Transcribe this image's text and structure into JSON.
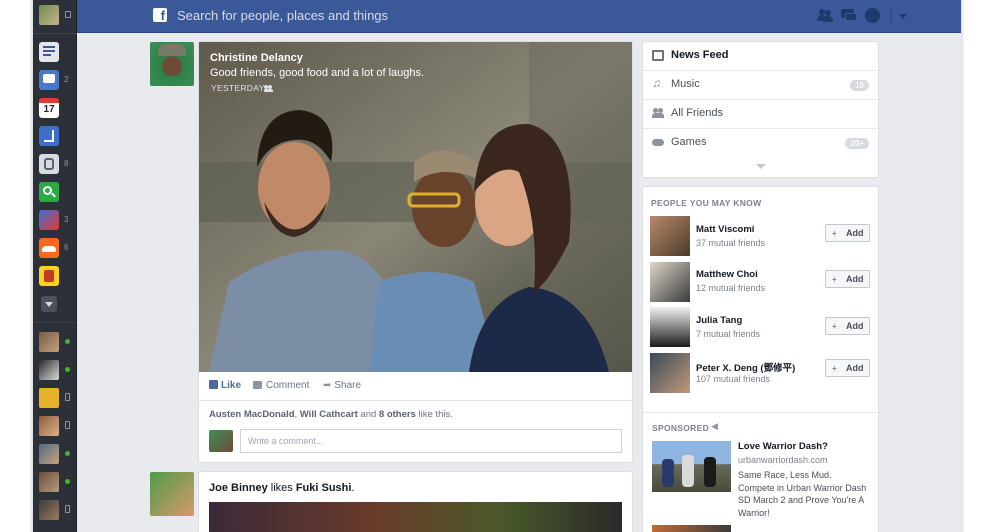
{
  "topbar": {
    "logo": "f",
    "search_placeholder": "Search for people, places and things",
    "icons": [
      "friend-requests-icon",
      "messages-icon",
      "notifications-icon",
      "settings-arrow-icon"
    ]
  },
  "rail": {
    "app_counts": {
      "messages": "2",
      "events": "17",
      "app4": "8",
      "app6": "3",
      "app7": "6"
    }
  },
  "post": {
    "author": "Christine Delancy",
    "caption": "Good friends, good food and a lot of laughs.",
    "timestamp": "YESTERDAY",
    "actions": {
      "like": "Like",
      "comment": "Comment",
      "share": "Share"
    },
    "likes": {
      "name1": "Austen MacDonald",
      "sep": ", ",
      "name2": "Will Cathcart",
      "and": " and ",
      "others": "8 others",
      "suffix": " like this."
    },
    "comment_placeholder": "Write a comment..."
  },
  "post2": {
    "actor": "Joe Binney",
    "verb": " likes ",
    "object": "Fuki Sushi",
    "punct": "."
  },
  "nav": {
    "items": [
      {
        "label": "News Feed",
        "badge": ""
      },
      {
        "label": "Music",
        "badge": "10"
      },
      {
        "label": "All Friends",
        "badge": ""
      },
      {
        "label": "Games",
        "badge": "20+"
      }
    ]
  },
  "pymk": {
    "heading": "PEOPLE YOU MAY KNOW",
    "add_label": "Add",
    "people": [
      {
        "name": "Matt Viscomi",
        "mutual": "37 mutual friends"
      },
      {
        "name": "Matthew Choi",
        "mutual": "12 mutual friends"
      },
      {
        "name": "Julia Tang",
        "mutual": "7 mutual friends"
      },
      {
        "name": "Peter X. Deng (鄧修平)",
        "mutual": "107 mutual friends"
      }
    ]
  },
  "sponsored": {
    "heading": "SPONSORED",
    "title": "Love Warrior Dash?",
    "url": "urbanwarriordash.com",
    "body": "Same Race, Less Mud. Compete in Urban Warrior Dash SD March 2 and Prove You're A Warrior!"
  },
  "colors": {
    "brand": "#3b5998",
    "page_bg": "#e9eaed",
    "rail_bg": "#2b3039",
    "presence": "#42b72a"
  }
}
